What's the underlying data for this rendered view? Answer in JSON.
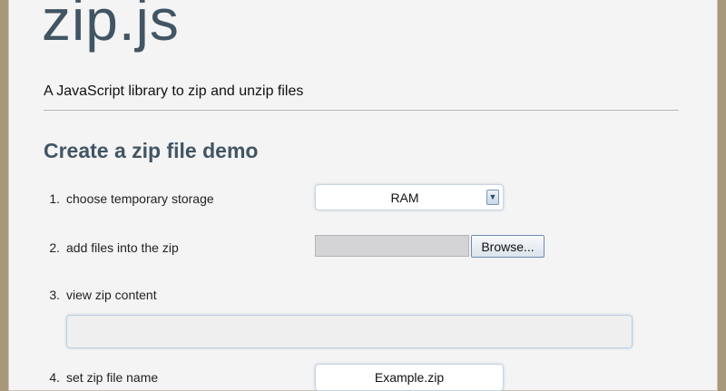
{
  "header": {
    "title": "zip.js",
    "tagline": "A JavaScript library to zip and unzip files"
  },
  "demo": {
    "title": "Create a zip file demo",
    "steps": [
      {
        "number": "1.",
        "label": "choose temporary storage"
      },
      {
        "number": "2.",
        "label": "add files into the zip"
      },
      {
        "number": "3.",
        "label": "view zip content"
      },
      {
        "number": "4.",
        "label": "set zip file name"
      }
    ],
    "storage_select": {
      "selected": "RAM",
      "icon": "chevron-down-icon"
    },
    "file_input": {
      "browse_label": "Browse..."
    },
    "filename_input": {
      "value": "Example.zip"
    }
  },
  "colors": {
    "heading": "#415564",
    "page_background": "#f4f4f4",
    "frame": "#a8987a"
  }
}
